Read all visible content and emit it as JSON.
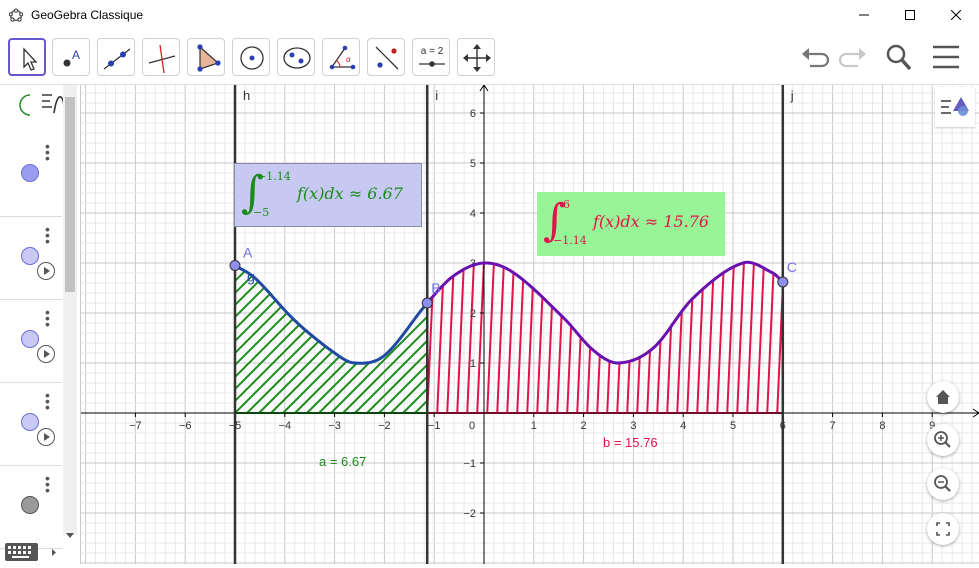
{
  "window": {
    "title": "GeoGebra Classique"
  },
  "toolbar": {
    "tools": [
      "move-tool",
      "point-tool",
      "line-tool",
      "perpendicular-line-tool",
      "polygon-tool",
      "circle-center-tool",
      "conic-tool",
      "angle-tool",
      "reflect-tool",
      "slider-tool",
      "move-graphics-view-tool"
    ],
    "slider_label": "a = 2"
  },
  "algebra": {
    "rows": [
      {
        "color": "#9a9cf0",
        "has_play": false
      },
      {
        "color": "#c8c9f5",
        "has_play": true
      },
      {
        "color": "#c8c9f5",
        "has_play": true
      },
      {
        "color": "#c8c9f5",
        "has_play": true
      },
      {
        "color": "#9a9a9a",
        "has_play": false
      }
    ]
  },
  "graph": {
    "x_ticks": [
      "−7",
      "−6",
      "−5",
      "−4",
      "−3",
      "−2",
      "−1",
      "0",
      "1",
      "2",
      "3",
      "4",
      "5",
      "6",
      "7",
      "8",
      "9"
    ],
    "y_ticks": [
      "−2",
      "−1",
      "1",
      "2",
      "3",
      "4",
      "5",
      "6"
    ],
    "line_labels": {
      "h": "h",
      "i": "i",
      "j": "j"
    },
    "points": {
      "A": "A",
      "B": "B",
      "C": "C"
    },
    "curve_label": "g",
    "integral1": {
      "upper": "−1.14",
      "lower": "−5",
      "body": "f(x)dx ≈ 6.67",
      "bg": "#c7c9f2"
    },
    "integral2": {
      "upper": "6",
      "lower": "−1.14",
      "body": "f(x)dx ≈ 15.76",
      "bg": "#97f597"
    },
    "value_a": "a = 6.67",
    "value_b": "b = 15.76",
    "colors": {
      "green": "#1a8c1a",
      "red": "#e0134a",
      "blue": "#1f4aa0",
      "purple": "#6b10b0",
      "point": "#8d90f0"
    }
  }
}
